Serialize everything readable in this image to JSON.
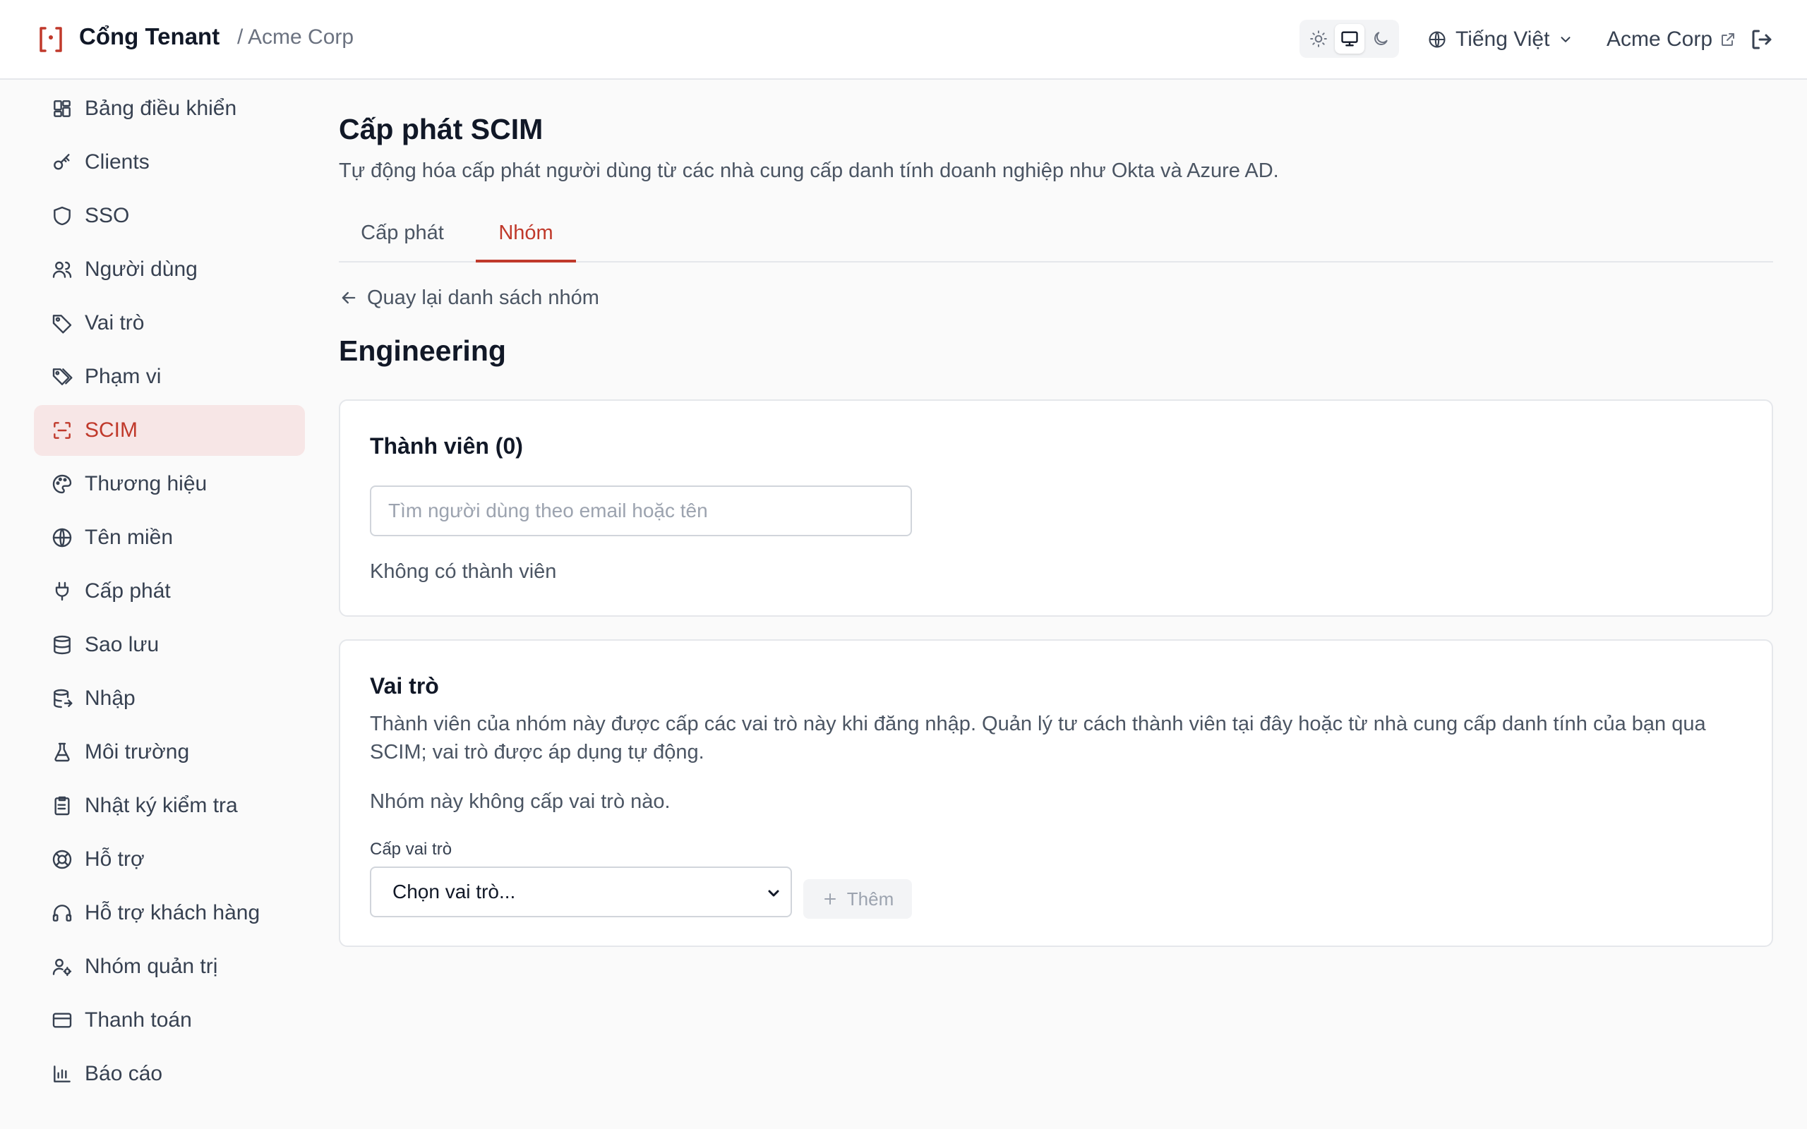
{
  "header": {
    "brand": "Cổng Tenant",
    "breadcrumb": "/ Acme Corp",
    "theme_modes": [
      "light",
      "system",
      "dark"
    ],
    "theme_active": "system",
    "language": "Tiếng Việt",
    "tenant_link": "Acme Corp",
    "accent_color": "#c0392b"
  },
  "sidebar": {
    "items": [
      {
        "label": "Bảng điều khiển",
        "icon": "dashboard-icon"
      },
      {
        "label": "Clients",
        "icon": "key-icon"
      },
      {
        "label": "SSO",
        "icon": "shield-icon"
      },
      {
        "label": "Người dùng",
        "icon": "users-icon"
      },
      {
        "label": "Vai trò",
        "icon": "tag-icon"
      },
      {
        "label": "Phạm vi",
        "icon": "tags-icon"
      },
      {
        "label": "SCIM",
        "icon": "scan-icon",
        "active": true
      },
      {
        "label": "Thương hiệu",
        "icon": "palette-icon"
      },
      {
        "label": "Tên miền",
        "icon": "globe-icon"
      },
      {
        "label": "Cấp phát",
        "icon": "plug-icon"
      },
      {
        "label": "Sao lưu",
        "icon": "database-icon"
      },
      {
        "label": "Nhập",
        "icon": "database-import-icon"
      },
      {
        "label": "Môi trường",
        "icon": "flask-icon"
      },
      {
        "label": "Nhật ký kiểm tra",
        "icon": "clipboard-list-icon"
      },
      {
        "label": "Hỗ trợ",
        "icon": "lifebuoy-icon"
      },
      {
        "label": "Hỗ trợ khách hàng",
        "icon": "headphones-icon"
      },
      {
        "label": "Nhóm quản trị",
        "icon": "user-cog-icon"
      },
      {
        "label": "Thanh toán",
        "icon": "credit-card-icon"
      },
      {
        "label": "Báo cáo",
        "icon": "bar-chart-icon"
      }
    ]
  },
  "main": {
    "title": "Cấp phát SCIM",
    "description": "Tự động hóa cấp phát người dùng từ các nhà cung cấp danh tính doanh nghiệp như Okta và Azure AD.",
    "tabs": [
      {
        "label": "Cấp phát",
        "active": false
      },
      {
        "label": "Nhóm",
        "active": true
      }
    ],
    "back_link": "Quay lại danh sách nhóm",
    "group_name": "Engineering",
    "members_card": {
      "title": "Thành viên (0)",
      "search_placeholder": "Tìm người dùng theo email hoặc tên",
      "empty_text": "Không có thành viên"
    },
    "roles_card": {
      "title": "Vai trò",
      "description": "Thành viên của nhóm này được cấp các vai trò này khi đăng nhập. Quản lý tư cách thành viên tại đây hoặc từ nhà cung cấp danh tính của bạn qua SCIM; vai trò được áp dụng tự động.",
      "empty_text": "Nhóm này không cấp vai trò nào.",
      "select_label": "Cấp vai trò",
      "select_value": "Chọn vai trò...",
      "add_button": "Thêm"
    }
  }
}
